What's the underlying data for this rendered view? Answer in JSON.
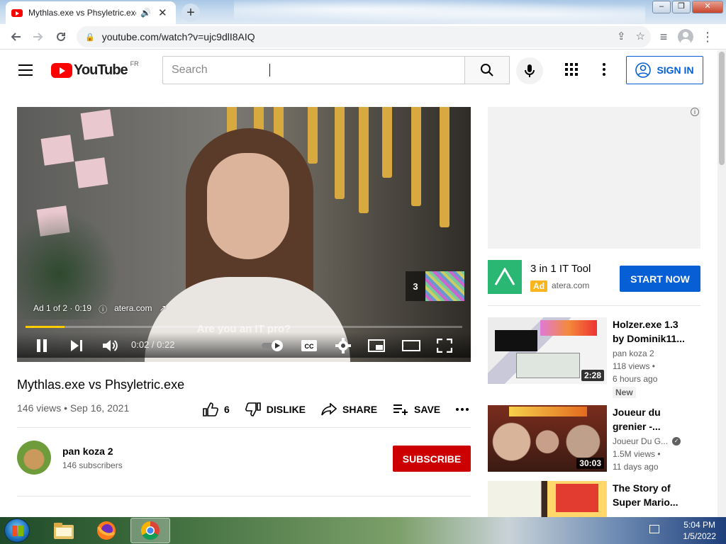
{
  "browser": {
    "tab_title": "Mythlas.exe vs Phsyletric.exe",
    "url": "youtube.com/watch?v=ujc9dlI8AIQ"
  },
  "youtube": {
    "logo_text": "YouTube",
    "country_code": "FR",
    "search_placeholder": "Search",
    "signin_label": "SIGN IN"
  },
  "player": {
    "ad_label": "Ad 1 of 2 · 0:19",
    "ad_domain": "atera.com",
    "skip_count": "3",
    "caption": "Are you an IT pro?",
    "time": "0:02 / 0:22",
    "progress": 0.09
  },
  "video": {
    "title": "Mythlas.exe vs Phsyletric.exe",
    "meta": "146 views • Sep 16, 2021",
    "likes": "6",
    "dislike_label": "DISLIKE",
    "share_label": "SHARE",
    "save_label": "SAVE"
  },
  "channel": {
    "name": "pan koza 2",
    "subscribers": "146 subscribers",
    "subscribe_label": "SUBSCRIBE"
  },
  "promo": {
    "title": "3 in 1 IT Tool",
    "ad_tag": "Ad",
    "domain": "atera.com",
    "cta": "START NOW"
  },
  "recommendations": [
    {
      "title": "Holzer.exe 1.3 by Dominik11...",
      "channel": "pan koza 2",
      "views": "118 views •",
      "age": "6 hours ago",
      "badge": "New",
      "duration": "2:28"
    },
    {
      "title": "Joueur du grenier -...",
      "channel": "Joueur Du G...",
      "views": "1.5M views •",
      "age": "11 days ago",
      "duration": "30:03"
    },
    {
      "title": "The Story of Super Mario..."
    }
  ],
  "taskbar": {
    "time": "5:04 PM",
    "date": "1/5/2022"
  },
  "colors": {
    "youtube_red": "#ff0000",
    "subscribe_red": "#cc0000",
    "link_blue": "#065fd4",
    "ad_yellow": "#f9b51d",
    "progress_yellow": "#ffcc00",
    "atera_green": "#2ab673"
  }
}
